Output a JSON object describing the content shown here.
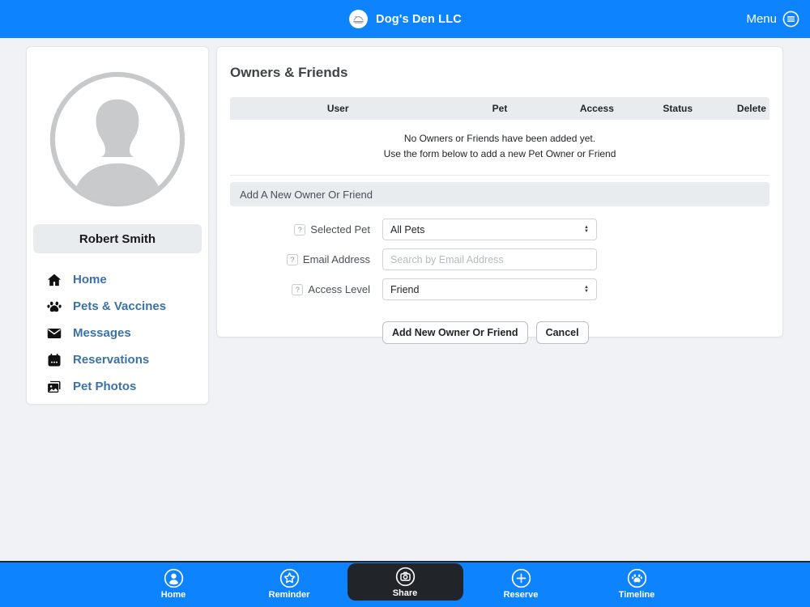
{
  "colors": {
    "primary_blue": "#0d84fe",
    "page_bg": "#f0f2f5",
    "bar_gray": "#e9ecef",
    "link_blue": "#3a72a8",
    "active_pill": "#212529"
  },
  "top_bar": {
    "brand": "Dog's Den LLC",
    "menu_label": "Menu"
  },
  "sidebar": {
    "user_name": "Robert Smith",
    "items": [
      {
        "icon": "home-icon",
        "label": "Home"
      },
      {
        "icon": "paw-icon",
        "label": "Pets & Vaccines"
      },
      {
        "icon": "envelope-icon",
        "label": "Messages"
      },
      {
        "icon": "calendar-icon",
        "label": "Reservations"
      },
      {
        "icon": "photos-icon",
        "label": "Pet Photos"
      }
    ]
  },
  "main": {
    "title": "Owners & Friends",
    "table": {
      "headers": [
        "User",
        "Pet",
        "Access",
        "Status",
        "Delete"
      ],
      "empty_line1": "No Owners or Friends have been added yet.",
      "empty_line2": "Use the form below to add a new Pet Owner or Friend"
    },
    "form": {
      "section_title": "Add A New Owner Or Friend",
      "help_glyph": "?",
      "fields": [
        {
          "label": "Selected Pet",
          "type": "select",
          "value": "All Pets"
        },
        {
          "label": "Email Address",
          "type": "input",
          "placeholder": "Search by Email Address"
        },
        {
          "label": "Access Level",
          "type": "select",
          "value": "Friend"
        }
      ],
      "submit_label": "Add New Owner Or Friend",
      "cancel_label": "Cancel"
    }
  },
  "bottom_bar": {
    "items": [
      {
        "icon": "person-circle-icon",
        "label": "Home",
        "active": false
      },
      {
        "icon": "star-circle-icon",
        "label": "Reminder",
        "active": false
      },
      {
        "icon": "camera-circle-icon",
        "label": "Share",
        "active": true
      },
      {
        "icon": "plus-circle-icon",
        "label": "Reserve",
        "active": false
      },
      {
        "icon": "paw-circle-icon",
        "label": "Timeline",
        "active": false
      }
    ]
  }
}
